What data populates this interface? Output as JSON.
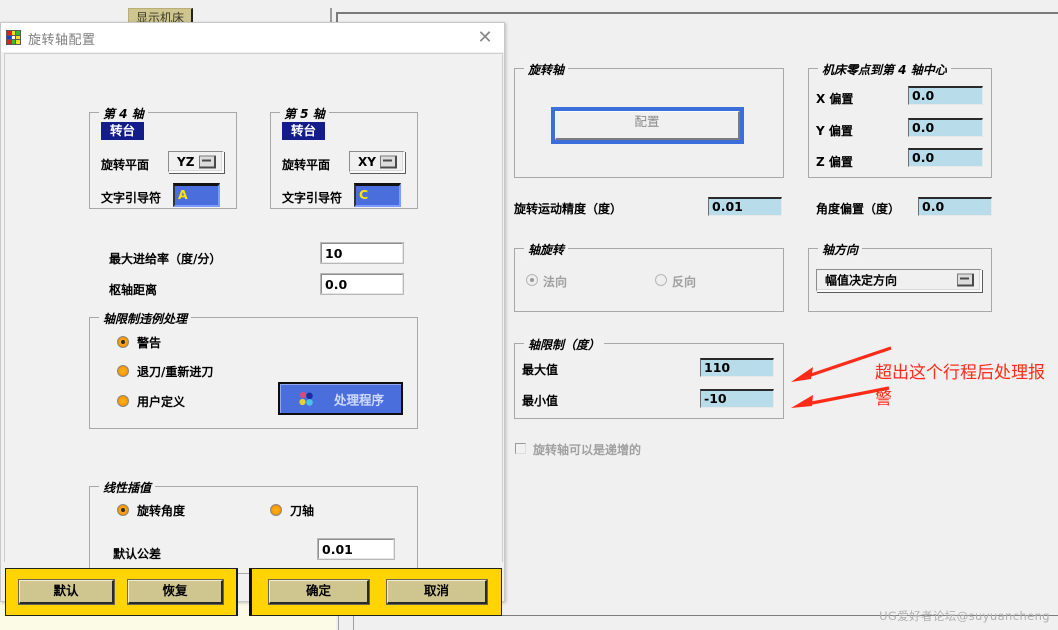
{
  "background": {
    "toolbar_button": "显示机床"
  },
  "dialog": {
    "title": "旋转轴配置",
    "close_icon": "close-icon",
    "axis4": {
      "legend": "第 4 轴",
      "type_chip": "转台",
      "plane_label": "旋转平面",
      "plane_value": "YZ",
      "leader_label": "文字引导符",
      "leader_value": "A"
    },
    "axis5": {
      "legend": "第 5 轴",
      "type_chip": "转台",
      "plane_label": "旋转平面",
      "plane_value": "XY",
      "leader_label": "文字引导符",
      "leader_value": "C"
    },
    "max_feed_label": "最大进给率（度/分）",
    "max_feed_value": "10",
    "pivot_label": "枢轴距离",
    "pivot_value": "0.0",
    "limit_violation": {
      "legend": "轴限制违例处理",
      "options": [
        "警告",
        "退刀/重新进刀",
        "用户定义"
      ],
      "selected_index": 0,
      "handler_button": "处理程序"
    },
    "linear_interp": {
      "legend": "线性插值",
      "options": [
        "旋转角度",
        "刀轴"
      ],
      "selected_index": 0,
      "tolerance_label": "默认公差",
      "tolerance_value": "0.01"
    },
    "buttons": {
      "defaults": "默认",
      "restore": "恢复",
      "ok": "确定",
      "cancel": "取消"
    }
  },
  "right_panel": {
    "rotary_axis": {
      "legend": "旋转轴",
      "config_button": "配置"
    },
    "zero_to_center": {
      "legend": "机床零点到第 4 轴中心",
      "rows": [
        {
          "label": "X 偏置",
          "value": "0.0"
        },
        {
          "label": "Y 偏置",
          "value": "0.0"
        },
        {
          "label": "Z 偏置",
          "value": "0.0"
        }
      ]
    },
    "motion_accuracy_label": "旋转运动精度（度）",
    "motion_accuracy_value": "0.01",
    "angle_offset_label": "角度偏置（度）",
    "angle_offset_value": "0.0",
    "axis_rotation": {
      "legend": "轴旋转",
      "options": [
        "法向",
        "反向"
      ],
      "selected_index": 0,
      "disabled": true
    },
    "axis_direction": {
      "legend": "轴方向",
      "value": "幅值决定方向"
    },
    "axis_limits": {
      "legend": "轴限制（度）",
      "max_label": "最大值",
      "max_value": "110",
      "min_label": "最小值",
      "min_value": "-10"
    },
    "incremental_checkbox": "旋转轴可以是递增的"
  },
  "annotation": {
    "text": "超出这个行程后处理报警",
    "color": "#ff2a17"
  },
  "watermark": "UG爱好者论坛@suyuancheng"
}
